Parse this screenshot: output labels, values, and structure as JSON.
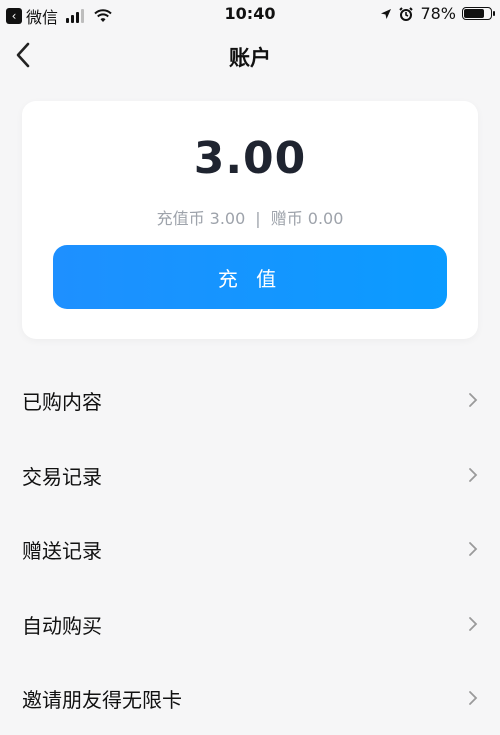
{
  "status_bar": {
    "back_app": "微信",
    "time": "10:40",
    "battery_pct": "78%",
    "battery_level": 0.78
  },
  "nav": {
    "title": "账户"
  },
  "account": {
    "balance": "3.00",
    "recharge_coins_label": "充值币 3.00",
    "separator": "|",
    "gift_coins_label": "赠币 0.00",
    "recharge_button": "充 值"
  },
  "menu": [
    {
      "label": "已购内容"
    },
    {
      "label": "交易记录"
    },
    {
      "label": "赠送记录"
    },
    {
      "label": "自动购买"
    },
    {
      "label": "邀请朋友得无限卡"
    }
  ],
  "colors": {
    "accent": "#1e90ff",
    "text": "#111111",
    "muted": "#9ea3ab",
    "background": "#f6f6f7"
  }
}
